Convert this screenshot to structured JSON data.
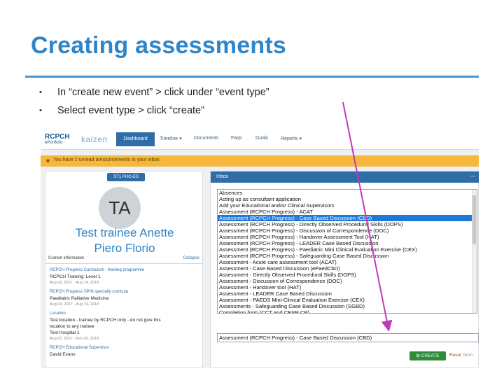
{
  "slide": {
    "title": "Creating assessments",
    "bullets": [
      "In “create new event” > click under “event type”",
      "Select event type > click “create”"
    ]
  },
  "navbar": {
    "logo": "RCPCH",
    "logo_sub": "ePortfolio",
    "brand": "kaizen",
    "items": [
      "Dashboard",
      "Timeline ▾",
      "Documents",
      "Faqs",
      "Goals",
      "Reports ▾"
    ]
  },
  "banner": {
    "text": "You have 2 unread announcements in your inbox."
  },
  "profile": {
    "tag": "ST1 PHO-ES",
    "initials": "TA",
    "name_line1": "Test trainee Anette",
    "name_line2": "Piero Florio",
    "info_label": "Current information",
    "collapse": "Collapse",
    "entries": [
      "RCPCH Progress Curriculum - training programme",
      "RCPCH Training: Level 1",
      "Aug 02, 2017 - Aug 14, 2018",
      "RCPCH Progress SPIN specialty curricula",
      "Paediatric Palliative Medicine",
      "Aug 04, 2017 - Aug 14, 2018",
      "Location",
      "Test location - trainee by RCPCH only - do not give this",
      "location to any trainee",
      "Test Hospital 1",
      "Aug 07, 2017 - Feb 03, 2018",
      "RCPCH Educational Supervisor",
      "David Evans"
    ]
  },
  "inbox": {
    "title": "Inbox",
    "dash": "—"
  },
  "event_type": {
    "options": [
      "Absences",
      "Acting up as consultant application",
      "Add your Educational and/or Clinical Supervisors",
      "Assessment (RCPCH Progress) - ACAT",
      "Assessment (RCPCH Progress) - Case Based Discussion (CBD)",
      "Assessment (RCPCH Progress) - Directly Observed Procedural Skills (DOPS)",
      "Assessment (RCPCH Progress) - Discussion of Correspondence (DOC)",
      "Assessment (RCPCH Progress) - Handover Assessment Tool (HAT)",
      "Assessment (RCPCH Progress) - LEADER Case Based Discussion",
      "Assessment (RCPCH Progress) - Paediatric Mini Clinical Evaluation Exercise (CEX)",
      "Assessment (RCPCH Progress) - Safeguarding Case Based Discussion",
      "Assessment - Acute care assessment tool (ACAT)",
      "Assessment - Case Based Discussion (ePaedCbD)",
      "Assessment - Directly Observed Procedural Skills (DOPS)",
      "Assessment - Discussion of Correspondence (DOC)",
      "Assessment - Handover tool (HAT)",
      "Assessment - LEADER Case Based Discussion",
      "Assessment - PAEDS Mini-Clinical Evaluation Exercise (CEX)",
      "Assessments - Safeguarding Case Based Discussion (SGBD)",
      "Completion form (CCT and CESR CP)"
    ],
    "selected_index": 4,
    "selected_value": "Assessment (RCPCH Progress) - Case Based Discussion (CBD)",
    "create_label": "CREATE",
    "reset_label": "Reset",
    "reset_tail": "form"
  },
  "colors": {
    "title": "#2e86c9",
    "nav_active": "#2d6ea8",
    "banner": "#f5b83c",
    "selection": "#1e78d6",
    "create": "#2e8b3c",
    "arrow": "#c03ab8"
  }
}
